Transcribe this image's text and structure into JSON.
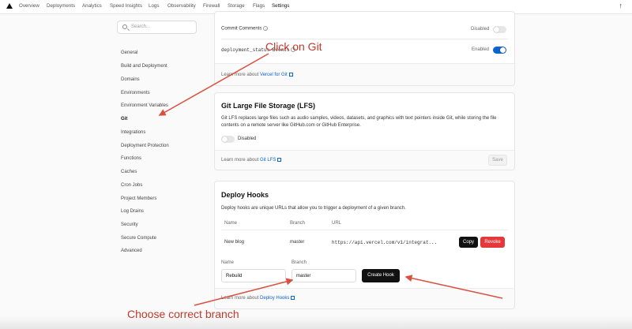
{
  "nav": {
    "tabs": [
      "Overview",
      "Deployments",
      "Analytics",
      "Speed Insights",
      "Logs",
      "Observability",
      "Firewall",
      "Storage",
      "Flags",
      "Settings"
    ],
    "active_tab": "Settings"
  },
  "sidebar": {
    "search_placeholder": "Search...",
    "items": [
      "General",
      "Build and Deployment",
      "Domains",
      "Environments",
      "Environment Variables",
      "Git",
      "Integrations",
      "Deployment Protection",
      "Functions",
      "Caches",
      "Cron Jobs",
      "Project Members",
      "Log Drains",
      "Security",
      "Secure Compute",
      "Advanced"
    ],
    "active_item": "Git"
  },
  "git_card": {
    "commit_comments_label": "Commit Comments",
    "commit_comments_state": "Disabled",
    "deployment_status_label": "deployment_status Events",
    "deployment_status_state": "Enabled",
    "learn_more_prefix": "Learn more about",
    "learn_more_link": "Vercel for Git"
  },
  "lfs_card": {
    "title": "Git Large File Storage (LFS)",
    "description_line1": "Git LFS replaces large files such as audio samples, videos, datasets, and graphics with text pointers inside Git, while storing the file",
    "description_line2": "contents on a remote server like GitHub.com or GitHub Enterprise.",
    "toggle_state": "Disabled",
    "learn_more_prefix": "Learn more about",
    "learn_more_link": "Git LFS",
    "save_label": "Save"
  },
  "hooks_card": {
    "title": "Deploy Hooks",
    "description": "Deploy hooks are unique URLs that allow you to trigger a deployment of a given branch.",
    "columns": [
      "Name",
      "Branch",
      "URL"
    ],
    "rows": [
      {
        "name": "New blog",
        "branch": "master",
        "url": "https://api.vercel.com/v1/integrat..."
      }
    ],
    "copy_label": "Copy",
    "revoke_label": "Revoke",
    "form": {
      "name_label": "Name",
      "name_value": "Rebuild",
      "branch_label": "Branch",
      "branch_value": "master",
      "create_label": "Create Hook"
    },
    "learn_more_prefix": "Learn more about",
    "learn_more_link": "Deploy Hooks"
  },
  "annotations": {
    "click_git": "Click on Git",
    "choose_branch": "Choose correct branch"
  },
  "colors": {
    "accent_blue": "#0b63ce",
    "annotation_red": "#c0392b",
    "revoke_red": "#e5383b"
  }
}
